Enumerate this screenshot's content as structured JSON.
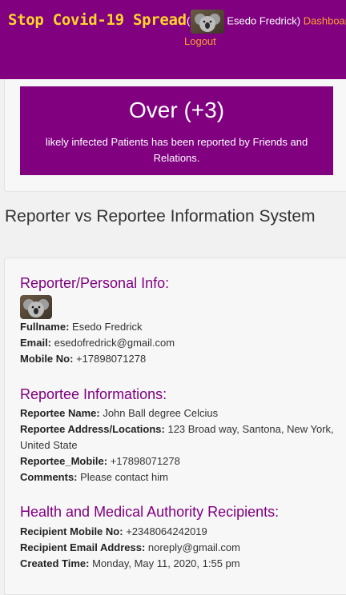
{
  "header": {
    "brand": "Stop Covid-19 Spread",
    "open_paren": "(",
    "user_name": "Esedo Fredrick",
    "close_paren": ")",
    "dashboard_link": "Dashboard",
    "logout_link": "Logout"
  },
  "alert": {
    "headline": "Over (+3)",
    "message": "likely infected Patients has been reported by Friends and Relations."
  },
  "page_title": "Reporter vs Reportee Information System",
  "reporter": {
    "heading": "Reporter/Personal Info:",
    "fullname_label": "Fullname:",
    "fullname": "Esedo Fredrick",
    "email_label": "Email:",
    "email": "esedofredrick@gmail.com",
    "mobile_label": "Mobile No:",
    "mobile": "+17898071278"
  },
  "reportee": {
    "heading": "Reportee Informations:",
    "name_label": "Reportee Name:",
    "name": "John Ball degree Celcius",
    "address_label": "Reportee Address/Locations:",
    "address": "123 Broad way, Santona, New York, United State",
    "mobile_label": "Reportee_Mobile:",
    "mobile": "+17898071278",
    "comments_label": "Comments:",
    "comments": "Please contact him"
  },
  "recipients": {
    "heading": "Health and Medical Authority Recipients:",
    "mobile_label": "Recipient Mobile No:",
    "mobile": "+2348064242019",
    "email_label": "Recipient Email Address:",
    "email": "noreply@gmail.com",
    "created_label": "Created Time:",
    "created": "Monday, May 11, 2020, 1:55 pm"
  },
  "colors": {
    "accent_purple": "#800080",
    "brand_yellow": "#ffd42a",
    "link_orange": "#ff9f2e"
  },
  "icons": {
    "avatar": "koala-avatar-image"
  }
}
